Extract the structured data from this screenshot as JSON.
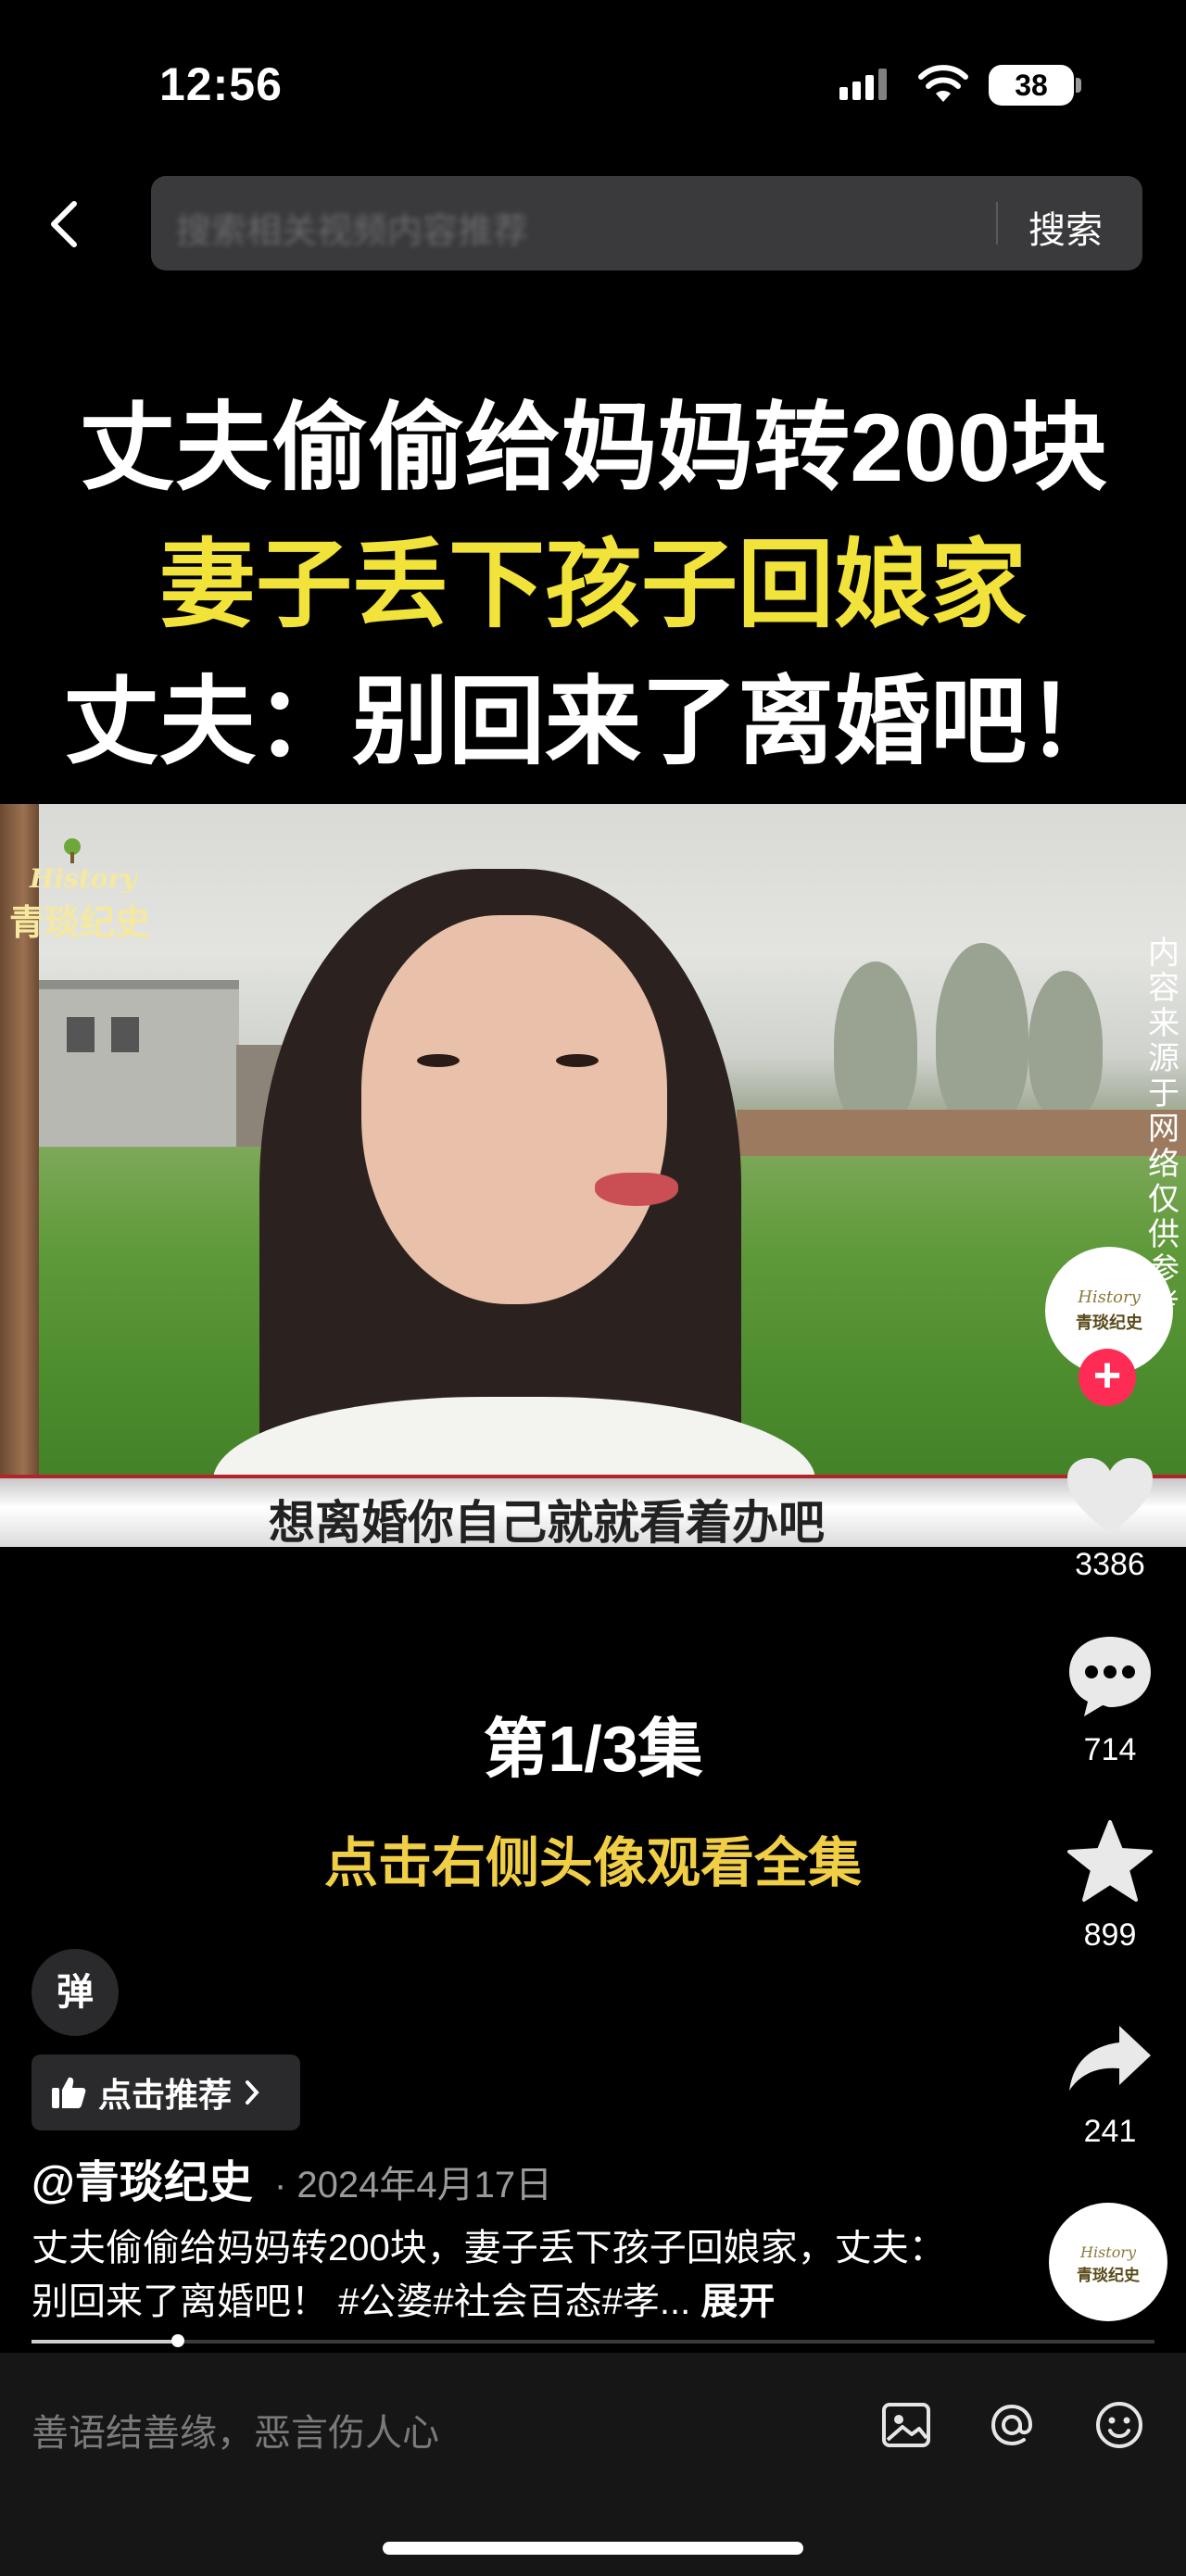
{
  "status_bar": {
    "time": "12:56",
    "battery": "38"
  },
  "search": {
    "placeholder": "搜索相关视频内容推荐",
    "button": "搜索"
  },
  "title_overlay": {
    "line1": "丈夫偷偷给妈妈转200块",
    "line2": "妻子丢下孩子回娘家",
    "line3": "丈夫：别回来了离婚吧！"
  },
  "video": {
    "watermark_en": "History",
    "watermark_cn": "青琰纪史",
    "caption": "想离婚你自己就就看着办吧",
    "side_text": "内容来源于网络 仅供参考"
  },
  "episode": {
    "label": "第1/3集",
    "hint": "点击右侧头像观看全集"
  },
  "rail": {
    "avatar_en": "History",
    "avatar_cn": "青琰纪史",
    "likes": "3386",
    "comments": "714",
    "favorites": "899",
    "shares": "241"
  },
  "info": {
    "danmu": "弹",
    "recommend": "点击推荐",
    "author": "@青琰纪史",
    "date": "· 2024年4月17日",
    "desc": "丈夫偷偷给妈妈转200块，妻子丢下孩子回娘家，丈夫：别回来了离婚吧！ #公婆#社会百态#孝...",
    "expand": "展开"
  },
  "playback": {
    "progress": 0.13
  },
  "comment_bar": {
    "placeholder": "善语结善缘，恶言伤人心"
  },
  "colors": {
    "accent_yellow": "#f2e33a",
    "follow_red": "#fe2c55"
  }
}
